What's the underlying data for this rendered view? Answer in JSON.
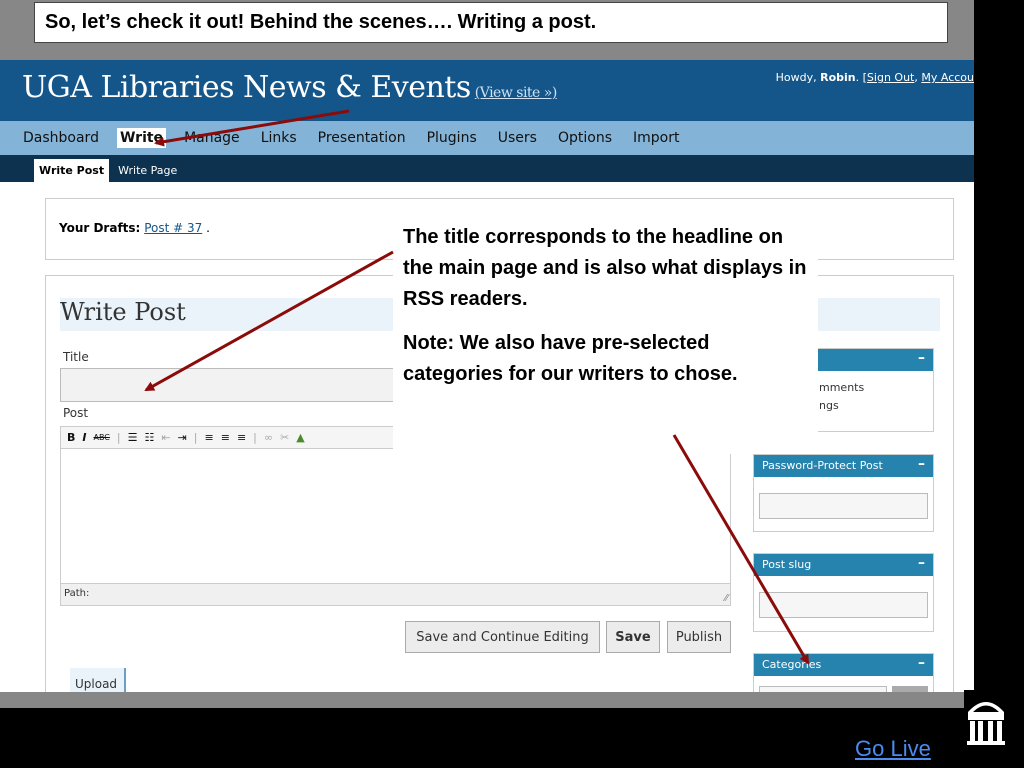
{
  "slide": {
    "title": "So, let’s check it out! Behind the scenes…. Writing a post.",
    "go_live": "Go Live"
  },
  "header": {
    "site_name": "UGA Libraries News & Events",
    "view_site": "(View site »)",
    "howdy_prefix": "Howdy, ",
    "user": "Robin",
    "howdy_mid": ". [",
    "sign_out": "Sign Out",
    "comma": ", ",
    "my_account": "My Accou"
  },
  "main_menu": [
    "Dashboard",
    "Write",
    "Manage",
    "Links",
    "Presentation",
    "Plugins",
    "Users",
    "Options",
    "Import"
  ],
  "sub_menu": [
    "Write Post",
    "Write Page"
  ],
  "drafts": {
    "label": "Your Drafts:",
    "link": "Post # 37",
    "suffix": " ."
  },
  "editor": {
    "heading": "Write Post",
    "title_label": "Title",
    "post_label": "Post",
    "path_label": "Path:",
    "buttons": {
      "save_continue": "Save and Continue Editing",
      "save": "Save",
      "publish": "Publish"
    },
    "upload": "Upload"
  },
  "sidebar": {
    "discussion_partial_1": "mments",
    "discussion_partial_2": "ngs",
    "password_protect": "Password-Protect Post",
    "post_slug": "Post slug",
    "categories": "Categories",
    "minus": "–"
  },
  "callout": {
    "para1": "The title corresponds to the headline on the main page and is also what displays in RSS readers.",
    "para2": "Note: We also have pre-selected categories for our writers to chose."
  },
  "colors": {
    "header_blue": "#14568a",
    "menu_blue": "#83b4d8",
    "submenu_navy": "#0d324f",
    "box_head_blue": "#2683ae",
    "arrow_red": "#8b0a0a",
    "link_blue": "#4a8cf0"
  }
}
